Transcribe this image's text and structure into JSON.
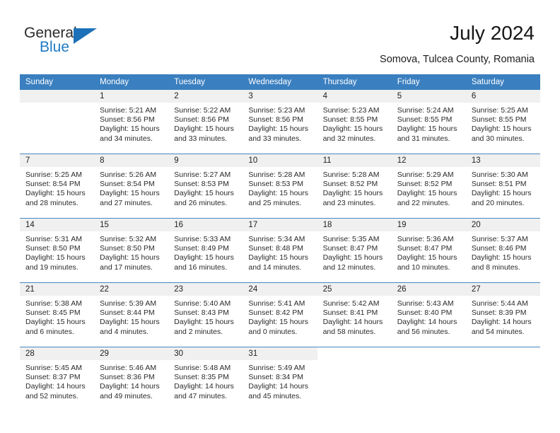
{
  "brand": {
    "name_top": "General",
    "name_bottom": "Blue",
    "triangle_color": "#1d71b8",
    "blue_text_color": "#1f7ac4"
  },
  "header": {
    "title": "July 2024",
    "location": "Somova, Tulcea County, Romania"
  },
  "theme": {
    "header_row_bg": "#3a7fbf",
    "daynum_bg": "#f0f0f0",
    "cell_border": "#4a86c0",
    "text_color": "#2a2a2a"
  },
  "weekdays": [
    "Sunday",
    "Monday",
    "Tuesday",
    "Wednesday",
    "Thursday",
    "Friday",
    "Saturday"
  ],
  "labels": {
    "sunrise_prefix": "Sunrise:",
    "sunset_prefix": "Sunset:",
    "daylight_prefix": "Daylight:"
  },
  "weeks": [
    [
      {
        "day": "",
        "lines": [],
        "empty": true
      },
      {
        "day": "1",
        "lines": [
          "Sunrise: 5:21 AM",
          "Sunset: 8:56 PM",
          "Daylight: 15 hours",
          "and 34 minutes."
        ]
      },
      {
        "day": "2",
        "lines": [
          "Sunrise: 5:22 AM",
          "Sunset: 8:56 PM",
          "Daylight: 15 hours",
          "and 33 minutes."
        ]
      },
      {
        "day": "3",
        "lines": [
          "Sunrise: 5:23 AM",
          "Sunset: 8:56 PM",
          "Daylight: 15 hours",
          "and 33 minutes."
        ]
      },
      {
        "day": "4",
        "lines": [
          "Sunrise: 5:23 AM",
          "Sunset: 8:55 PM",
          "Daylight: 15 hours",
          "and 32 minutes."
        ]
      },
      {
        "day": "5",
        "lines": [
          "Sunrise: 5:24 AM",
          "Sunset: 8:55 PM",
          "Daylight: 15 hours",
          "and 31 minutes."
        ]
      },
      {
        "day": "6",
        "lines": [
          "Sunrise: 5:25 AM",
          "Sunset: 8:55 PM",
          "Daylight: 15 hours",
          "and 30 minutes."
        ]
      }
    ],
    [
      {
        "day": "7",
        "lines": [
          "Sunrise: 5:25 AM",
          "Sunset: 8:54 PM",
          "Daylight: 15 hours",
          "and 28 minutes."
        ]
      },
      {
        "day": "8",
        "lines": [
          "Sunrise: 5:26 AM",
          "Sunset: 8:54 PM",
          "Daylight: 15 hours",
          "and 27 minutes."
        ]
      },
      {
        "day": "9",
        "lines": [
          "Sunrise: 5:27 AM",
          "Sunset: 8:53 PM",
          "Daylight: 15 hours",
          "and 26 minutes."
        ]
      },
      {
        "day": "10",
        "lines": [
          "Sunrise: 5:28 AM",
          "Sunset: 8:53 PM",
          "Daylight: 15 hours",
          "and 25 minutes."
        ]
      },
      {
        "day": "11",
        "lines": [
          "Sunrise: 5:28 AM",
          "Sunset: 8:52 PM",
          "Daylight: 15 hours",
          "and 23 minutes."
        ]
      },
      {
        "day": "12",
        "lines": [
          "Sunrise: 5:29 AM",
          "Sunset: 8:52 PM",
          "Daylight: 15 hours",
          "and 22 minutes."
        ]
      },
      {
        "day": "13",
        "lines": [
          "Sunrise: 5:30 AM",
          "Sunset: 8:51 PM",
          "Daylight: 15 hours",
          "and 20 minutes."
        ]
      }
    ],
    [
      {
        "day": "14",
        "lines": [
          "Sunrise: 5:31 AM",
          "Sunset: 8:50 PM",
          "Daylight: 15 hours",
          "and 19 minutes."
        ]
      },
      {
        "day": "15",
        "lines": [
          "Sunrise: 5:32 AM",
          "Sunset: 8:50 PM",
          "Daylight: 15 hours",
          "and 17 minutes."
        ]
      },
      {
        "day": "16",
        "lines": [
          "Sunrise: 5:33 AM",
          "Sunset: 8:49 PM",
          "Daylight: 15 hours",
          "and 16 minutes."
        ]
      },
      {
        "day": "17",
        "lines": [
          "Sunrise: 5:34 AM",
          "Sunset: 8:48 PM",
          "Daylight: 15 hours",
          "and 14 minutes."
        ]
      },
      {
        "day": "18",
        "lines": [
          "Sunrise: 5:35 AM",
          "Sunset: 8:47 PM",
          "Daylight: 15 hours",
          "and 12 minutes."
        ]
      },
      {
        "day": "19",
        "lines": [
          "Sunrise: 5:36 AM",
          "Sunset: 8:47 PM",
          "Daylight: 15 hours",
          "and 10 minutes."
        ]
      },
      {
        "day": "20",
        "lines": [
          "Sunrise: 5:37 AM",
          "Sunset: 8:46 PM",
          "Daylight: 15 hours",
          "and 8 minutes."
        ]
      }
    ],
    [
      {
        "day": "21",
        "lines": [
          "Sunrise: 5:38 AM",
          "Sunset: 8:45 PM",
          "Daylight: 15 hours",
          "and 6 minutes."
        ]
      },
      {
        "day": "22",
        "lines": [
          "Sunrise: 5:39 AM",
          "Sunset: 8:44 PM",
          "Daylight: 15 hours",
          "and 4 minutes."
        ]
      },
      {
        "day": "23",
        "lines": [
          "Sunrise: 5:40 AM",
          "Sunset: 8:43 PM",
          "Daylight: 15 hours",
          "and 2 minutes."
        ]
      },
      {
        "day": "24",
        "lines": [
          "Sunrise: 5:41 AM",
          "Sunset: 8:42 PM",
          "Daylight: 15 hours",
          "and 0 minutes."
        ]
      },
      {
        "day": "25",
        "lines": [
          "Sunrise: 5:42 AM",
          "Sunset: 8:41 PM",
          "Daylight: 14 hours",
          "and 58 minutes."
        ]
      },
      {
        "day": "26",
        "lines": [
          "Sunrise: 5:43 AM",
          "Sunset: 8:40 PM",
          "Daylight: 14 hours",
          "and 56 minutes."
        ]
      },
      {
        "day": "27",
        "lines": [
          "Sunrise: 5:44 AM",
          "Sunset: 8:39 PM",
          "Daylight: 14 hours",
          "and 54 minutes."
        ]
      }
    ],
    [
      {
        "day": "28",
        "lines": [
          "Sunrise: 5:45 AM",
          "Sunset: 8:37 PM",
          "Daylight: 14 hours",
          "and 52 minutes."
        ]
      },
      {
        "day": "29",
        "lines": [
          "Sunrise: 5:46 AM",
          "Sunset: 8:36 PM",
          "Daylight: 14 hours",
          "and 49 minutes."
        ]
      },
      {
        "day": "30",
        "lines": [
          "Sunrise: 5:48 AM",
          "Sunset: 8:35 PM",
          "Daylight: 14 hours",
          "and 47 minutes."
        ]
      },
      {
        "day": "31",
        "lines": [
          "Sunrise: 5:49 AM",
          "Sunset: 8:34 PM",
          "Daylight: 14 hours",
          "and 45 minutes."
        ]
      },
      {
        "day": "",
        "lines": [],
        "blank": true
      },
      {
        "day": "",
        "lines": [],
        "blank": true
      },
      {
        "day": "",
        "lines": [],
        "blank": true
      }
    ]
  ]
}
